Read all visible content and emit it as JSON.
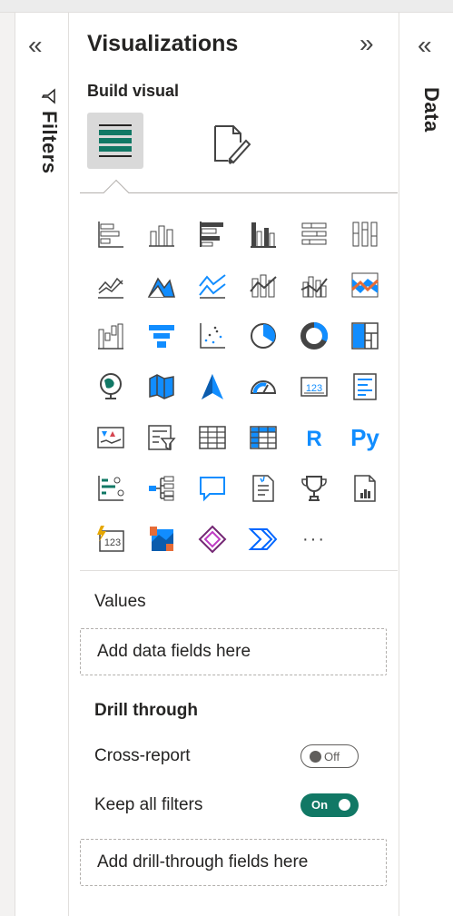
{
  "filters": {
    "label": "Filters",
    "collapse_glyph": "«"
  },
  "visualizations": {
    "title": "Visualizations",
    "expand_glyph": "»",
    "build_label": "Build visual",
    "icons": [
      "stacked-bar-chart-icon",
      "stacked-column-chart-icon",
      "clustered-bar-chart-icon",
      "clustered-column-chart-icon",
      "100-stacked-bar-chart-icon",
      "100-stacked-column-chart-icon",
      "line-chart-icon",
      "area-chart-icon",
      "stacked-area-chart-icon",
      "line-stacked-column-chart-icon",
      "line-clustered-column-chart-icon",
      "ribbon-chart-icon",
      "waterfall-chart-icon",
      "funnel-chart-icon",
      "scatter-chart-icon",
      "pie-chart-icon",
      "donut-chart-icon",
      "treemap-icon",
      "map-icon",
      "filled-map-icon",
      "azure-map-icon",
      "gauge-icon",
      "card-icon",
      "multi-row-card-icon",
      "kpi-icon",
      "slicer-icon",
      "table-icon",
      "matrix-icon",
      "r-visual-icon",
      "python-visual-icon",
      "key-influencers-icon",
      "decomposition-tree-icon",
      "qa-icon",
      "smart-narrative-icon",
      "goals-icon",
      "paginated-report-icon",
      "new-card-icon",
      "arcgis-map-icon",
      "power-apps-icon",
      "power-automate-icon",
      "more-visuals-icon"
    ],
    "r_text": "R",
    "py_text": "Py",
    "card_text": "123",
    "more_text": "···",
    "values_label": "Values",
    "values_drop": "Add data fields here",
    "drill_label": "Drill through",
    "cross_report_label": "Cross-report",
    "cross_report_state": "Off",
    "keep_filters_label": "Keep all filters",
    "keep_filters_state": "On",
    "drill_drop": "Add drill-through fields here"
  },
  "data": {
    "label": "Data",
    "collapse_glyph": "«"
  },
  "colors": {
    "accent_blue": "#118dff",
    "accent_teal": "#117865",
    "accent_orange": "#e66c37"
  }
}
